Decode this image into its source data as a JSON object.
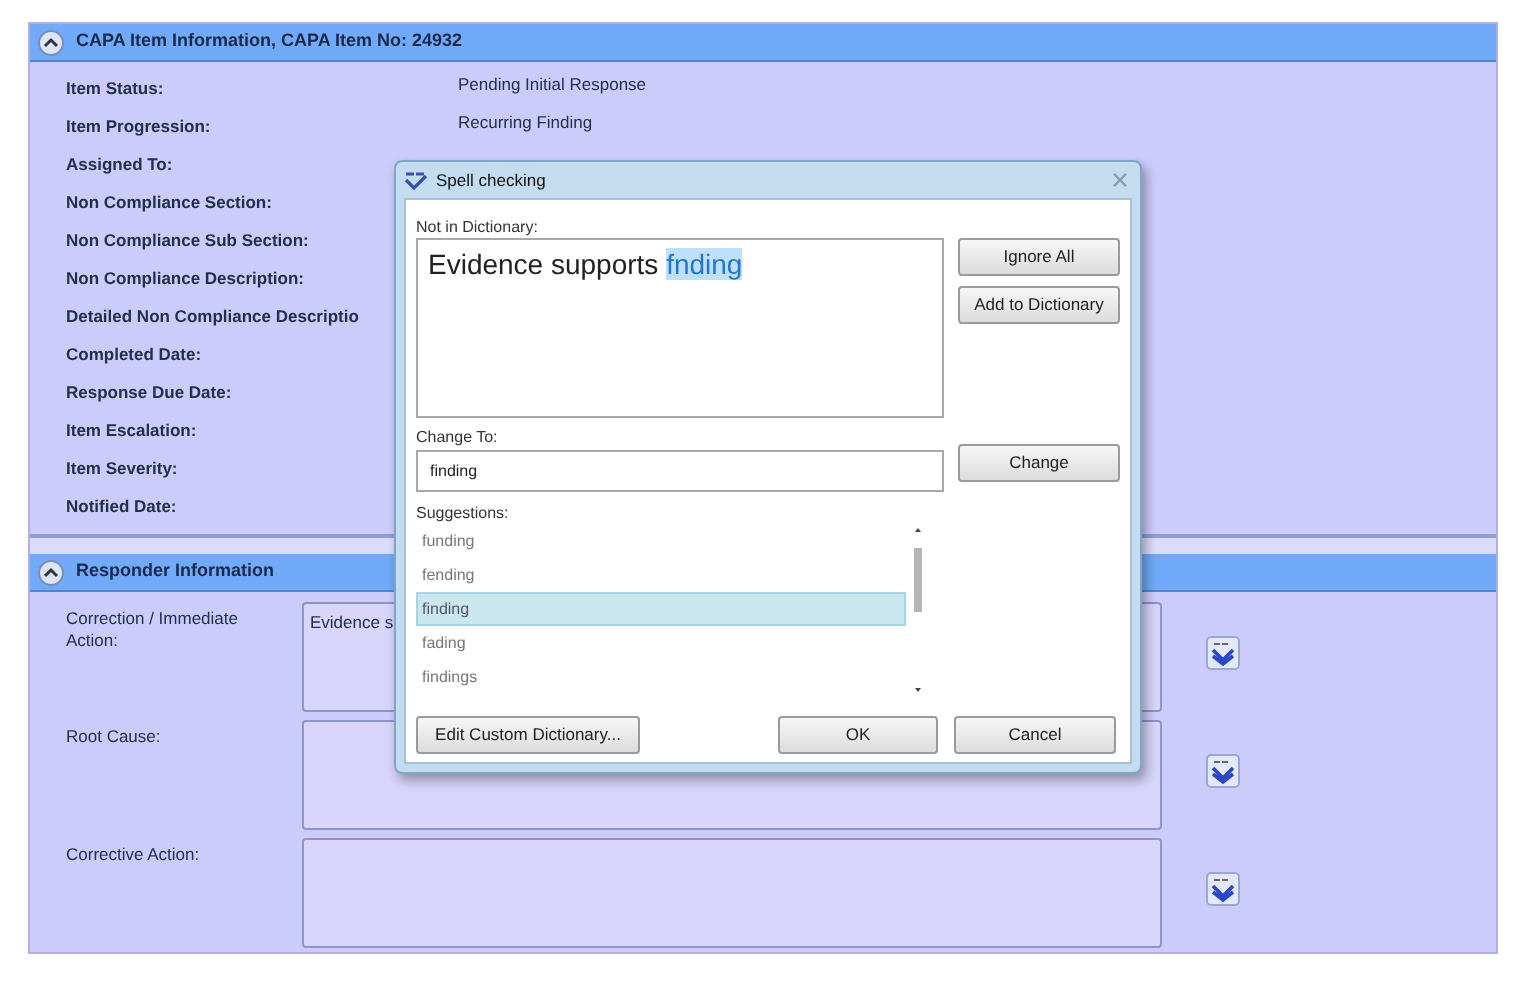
{
  "info_section": {
    "title": "CAPA Item Information, CAPA Item No: 24932",
    "expanded": true,
    "fields": [
      {
        "label": "Item Status:",
        "value": "Pending Initial Response"
      },
      {
        "label": "Item Progression:",
        "value": "Recurring Finding"
      },
      {
        "label": "Assigned To:"
      },
      {
        "label": "Non Compliance Section:"
      },
      {
        "label": "Non Compliance Sub Section:"
      },
      {
        "label": "Non Compliance Description:"
      },
      {
        "label": "Detailed Non Compliance Descriptio"
      },
      {
        "label": "Completed Date:"
      },
      {
        "label": "Response Due Date:"
      },
      {
        "label": "Item Escalation:"
      },
      {
        "label": "Item Severity:"
      },
      {
        "label": "Notified Date:"
      }
    ]
  },
  "responder_section": {
    "title": "Responder Information",
    "expanded": true,
    "fields": [
      {
        "label": "Correction / Immediate Action:",
        "value": "Evidence s"
      },
      {
        "label": "Root Cause:"
      },
      {
        "label": "Corrective Action:"
      }
    ]
  },
  "dialog": {
    "title": "Spell checking",
    "not_in_dictionary_label": "Not in Dictionary:",
    "sentence": {
      "text": "Evidence supports ",
      "flagged": "fnding"
    },
    "change_to_label": "Change To:",
    "change_to": "finding",
    "suggestions_label": "Suggestions:",
    "suggestions": [
      {
        "text": "funding",
        "selected": false
      },
      {
        "text": "fending",
        "selected": false
      },
      {
        "text": "finding",
        "selected": true
      },
      {
        "text": "fading",
        "selected": false
      },
      {
        "text": "findings",
        "selected": false
      }
    ],
    "side_buttons": [
      "Ignore All",
      "Add to Dictionary"
    ],
    "change_button": "Change",
    "custom_button": "Edit Custom Dictionary...",
    "ok_button": "OK",
    "cancel_button": "Cancel"
  }
}
